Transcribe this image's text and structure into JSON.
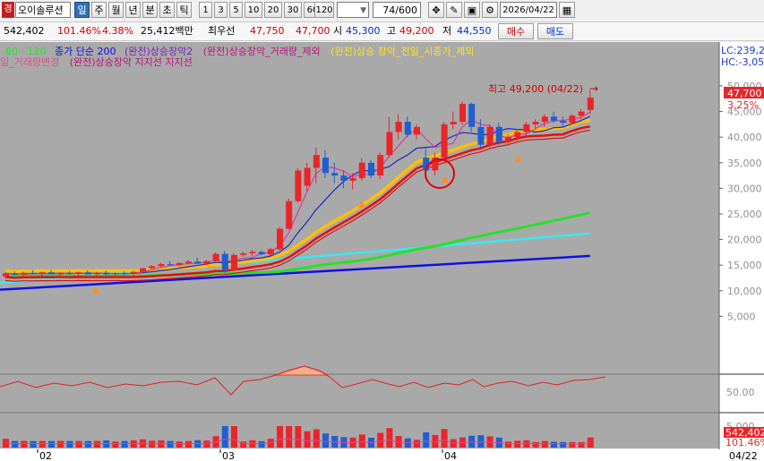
{
  "toolbar": {
    "market_badge": "경",
    "stock_name": "오이솔루션",
    "periods": [
      "일",
      "주",
      "월",
      "년",
      "분",
      "초",
      "틱"
    ],
    "active_period": "일",
    "intervals": [
      "1",
      "3",
      "5",
      "10",
      "20",
      "30",
      "60",
      "120"
    ],
    "count": "74/600",
    "date": "2026/04/22",
    "buy_label": "매수",
    "sell_label": "매도"
  },
  "info": {
    "volume": "542,402",
    "volume_ratio": "101.46%",
    "change_pct": "4.38%",
    "amount": "25,412백만",
    "preferred_label": "최우선",
    "ask": "47,750",
    "bid": "47,700",
    "open_label": "시",
    "open": "45,300",
    "high_label": "고",
    "high": "49,200",
    "low_label": "저",
    "low": "44,550"
  },
  "legend": {
    "line1_a": "60 · 120",
    "line1_b": "종가 단순 200",
    "line1_c": "(완전)상승장악2",
    "line1_d": "(완전)상승장악_거래량_제외",
    "line1_e": "(완전)상승 장악_전일_시종가_제외",
    "line2_a": "일_거래량변경",
    "line2_b": "(완전)상승장악 지지선 지지선"
  },
  "right_axis": {
    "lc": "LC:239,2",
    "hc": "HC:-3,05",
    "ticks": [
      "50,000",
      "45,000",
      "40,000",
      "35,000",
      "30,000",
      "25,000",
      "20,000",
      "15,000",
      "10,000",
      "5,000"
    ],
    "price_tag": "47,700",
    "pct_tag": "3.25%",
    "osc_tick": "50.00",
    "vol_tick": "5,000",
    "vol_tag": "542,402",
    "vol_pct_tag": "101.46%"
  },
  "annotation": {
    "high_note": "최고 49,200 (04/22)"
  },
  "date_axis": [
    "02",
    "03",
    "04",
    "04/22"
  ],
  "colors": {
    "up": "#e8262a",
    "down": "#1f5fd0",
    "bg": "#a9a9a9",
    "ma5": "#e0389c",
    "ma10": "#1a28c0",
    "ma20": "#ffc000",
    "ma60": "#28e028",
    "ma120": "#3ae8f0",
    "ma200": "#1010e0"
  },
  "chart_data": {
    "type": "candlestick",
    "y_range": [
      0,
      52000
    ],
    "candles": [
      [
        12800,
        13600,
        12500,
        13400
      ],
      [
        13400,
        13800,
        13000,
        13100
      ],
      [
        13100,
        13700,
        12900,
        13500
      ],
      [
        13500,
        14000,
        13200,
        13300
      ],
      [
        13300,
        13700,
        12900,
        13600
      ],
      [
        13600,
        14100,
        13300,
        13200
      ],
      [
        13200,
        13600,
        12800,
        13500
      ],
      [
        13500,
        13900,
        13100,
        13300
      ],
      [
        13300,
        13700,
        12900,
        13600
      ],
      [
        13600,
        14000,
        13200,
        13200
      ],
      [
        13200,
        13700,
        12900,
        13500
      ],
      [
        13500,
        13900,
        13000,
        13200
      ],
      [
        13200,
        13600,
        12900,
        13400
      ],
      [
        13400,
        13800,
        13000,
        13300
      ],
      [
        13300,
        13900,
        13000,
        13700
      ],
      [
        13700,
        14500,
        13400,
        14400
      ],
      [
        14400,
        15000,
        14100,
        14800
      ],
      [
        14800,
        15500,
        14500,
        15200
      ],
      [
        15200,
        15800,
        14900,
        15000
      ],
      [
        15000,
        15600,
        14800,
        15400
      ],
      [
        15400,
        16000,
        15100,
        15700
      ],
      [
        15700,
        16500,
        15400,
        15300
      ],
      [
        15300,
        16000,
        15000,
        15800
      ],
      [
        15800,
        17500,
        15600,
        17200
      ],
      [
        17200,
        17800,
        13500,
        14000
      ],
      [
        14000,
        17300,
        13800,
        17000
      ],
      [
        17000,
        17600,
        16700,
        17300
      ],
      [
        17300,
        18000,
        16800,
        17600
      ],
      [
        17600,
        17900,
        16900,
        17100
      ],
      [
        17100,
        18400,
        16900,
        18100
      ],
      [
        18100,
        22500,
        17900,
        22100
      ],
      [
        22100,
        28000,
        21900,
        27500
      ],
      [
        27500,
        34000,
        27200,
        33500
      ],
      [
        30500,
        35000,
        29500,
        34000
      ],
      [
        34000,
        38000,
        31000,
        36500
      ],
      [
        36000,
        37500,
        32000,
        33000
      ],
      [
        33000,
        35000,
        31000,
        32500
      ],
      [
        32500,
        33500,
        30000,
        31500
      ],
      [
        31500,
        33000,
        29800,
        32000
      ],
      [
        32000,
        36000,
        31500,
        35000
      ],
      [
        35000,
        35500,
        32000,
        32500
      ],
      [
        32500,
        37000,
        31800,
        36500
      ],
      [
        36500,
        44000,
        36000,
        41000
      ],
      [
        41000,
        44500,
        39500,
        43000
      ],
      [
        43000,
        44000,
        40000,
        40500
      ],
      [
        40500,
        42500,
        39500,
        42000
      ],
      [
        36000,
        38000,
        32000,
        33500
      ],
      [
        33500,
        37000,
        32500,
        36000
      ],
      [
        36000,
        43000,
        35500,
        42500
      ],
      [
        42500,
        45000,
        41500,
        43000
      ],
      [
        43000,
        47000,
        42500,
        46500
      ],
      [
        46500,
        46800,
        41000,
        42000
      ],
      [
        42000,
        43500,
        38000,
        38500
      ],
      [
        38500,
        42500,
        38000,
        42000
      ],
      [
        42000,
        42800,
        38500,
        39000
      ],
      [
        39000,
        40500,
        38500,
        40000
      ],
      [
        40000,
        41500,
        39000,
        41000
      ],
      [
        41000,
        43000,
        40200,
        42500
      ],
      [
        42500,
        43500,
        41500,
        43000
      ],
      [
        43000,
        44500,
        42000,
        44000
      ],
      [
        44000,
        45000,
        42800,
        43200
      ],
      [
        43200,
        44000,
        42000,
        42800
      ],
      [
        42800,
        44500,
        42500,
        44200
      ],
      [
        44200,
        45500,
        43500,
        45000
      ],
      [
        45300,
        49200,
        44550,
        47700
      ]
    ],
    "oscillator_label": "50.00",
    "volume_label": "542,402"
  }
}
